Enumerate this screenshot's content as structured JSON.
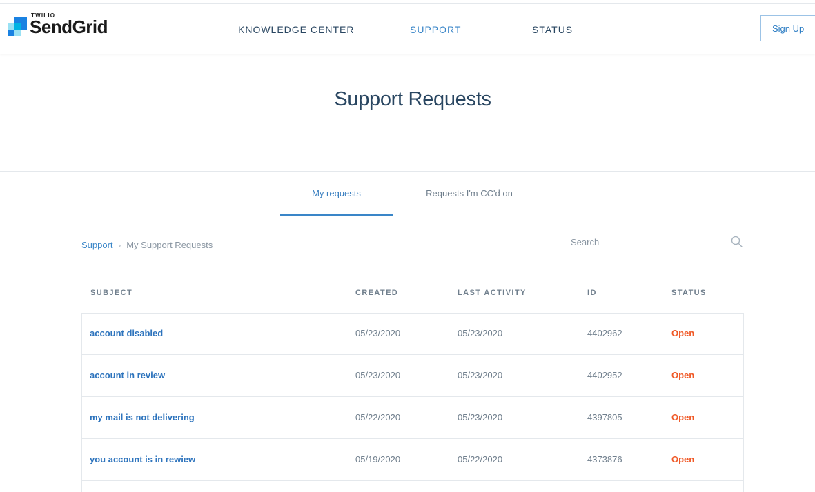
{
  "header": {
    "brand_small": "TWILIO",
    "brand": "SendGrid",
    "nav": [
      {
        "label": "KNOWLEDGE CENTER"
      },
      {
        "label": "SUPPORT"
      },
      {
        "label": "STATUS"
      }
    ],
    "signup_label": "Sign Up"
  },
  "page": {
    "title": "Support Requests"
  },
  "tabs": [
    {
      "label": "My requests",
      "active": true
    },
    {
      "label": "Requests I'm CC'd on",
      "active": false
    }
  ],
  "breadcrumb": {
    "root": "Support",
    "separator": "›",
    "current": "My Support Requests"
  },
  "search": {
    "placeholder": "Search",
    "value": ""
  },
  "table": {
    "headers": {
      "subject": "SUBJECT",
      "created": "CREATED",
      "last_activity": "LAST ACTIVITY",
      "id": "ID",
      "status": "STATUS"
    },
    "rows": [
      {
        "subject": "account disabled",
        "created": "05/23/2020",
        "last_activity": "05/23/2020",
        "id": "4402962",
        "status": "Open"
      },
      {
        "subject": "account in review",
        "created": "05/23/2020",
        "last_activity": "05/23/2020",
        "id": "4402952",
        "status": "Open"
      },
      {
        "subject": "my mail is not delivering",
        "created": "05/22/2020",
        "last_activity": "05/23/2020",
        "id": "4397805",
        "status": "Open"
      },
      {
        "subject": "you account is in rewiew",
        "created": "05/19/2020",
        "last_activity": "05/22/2020",
        "id": "4373876",
        "status": "Open"
      }
    ]
  },
  "colors": {
    "accent": "#3a86c8",
    "link": "#2e74bd",
    "status_open": "#f05a28",
    "heading": "#294661"
  }
}
